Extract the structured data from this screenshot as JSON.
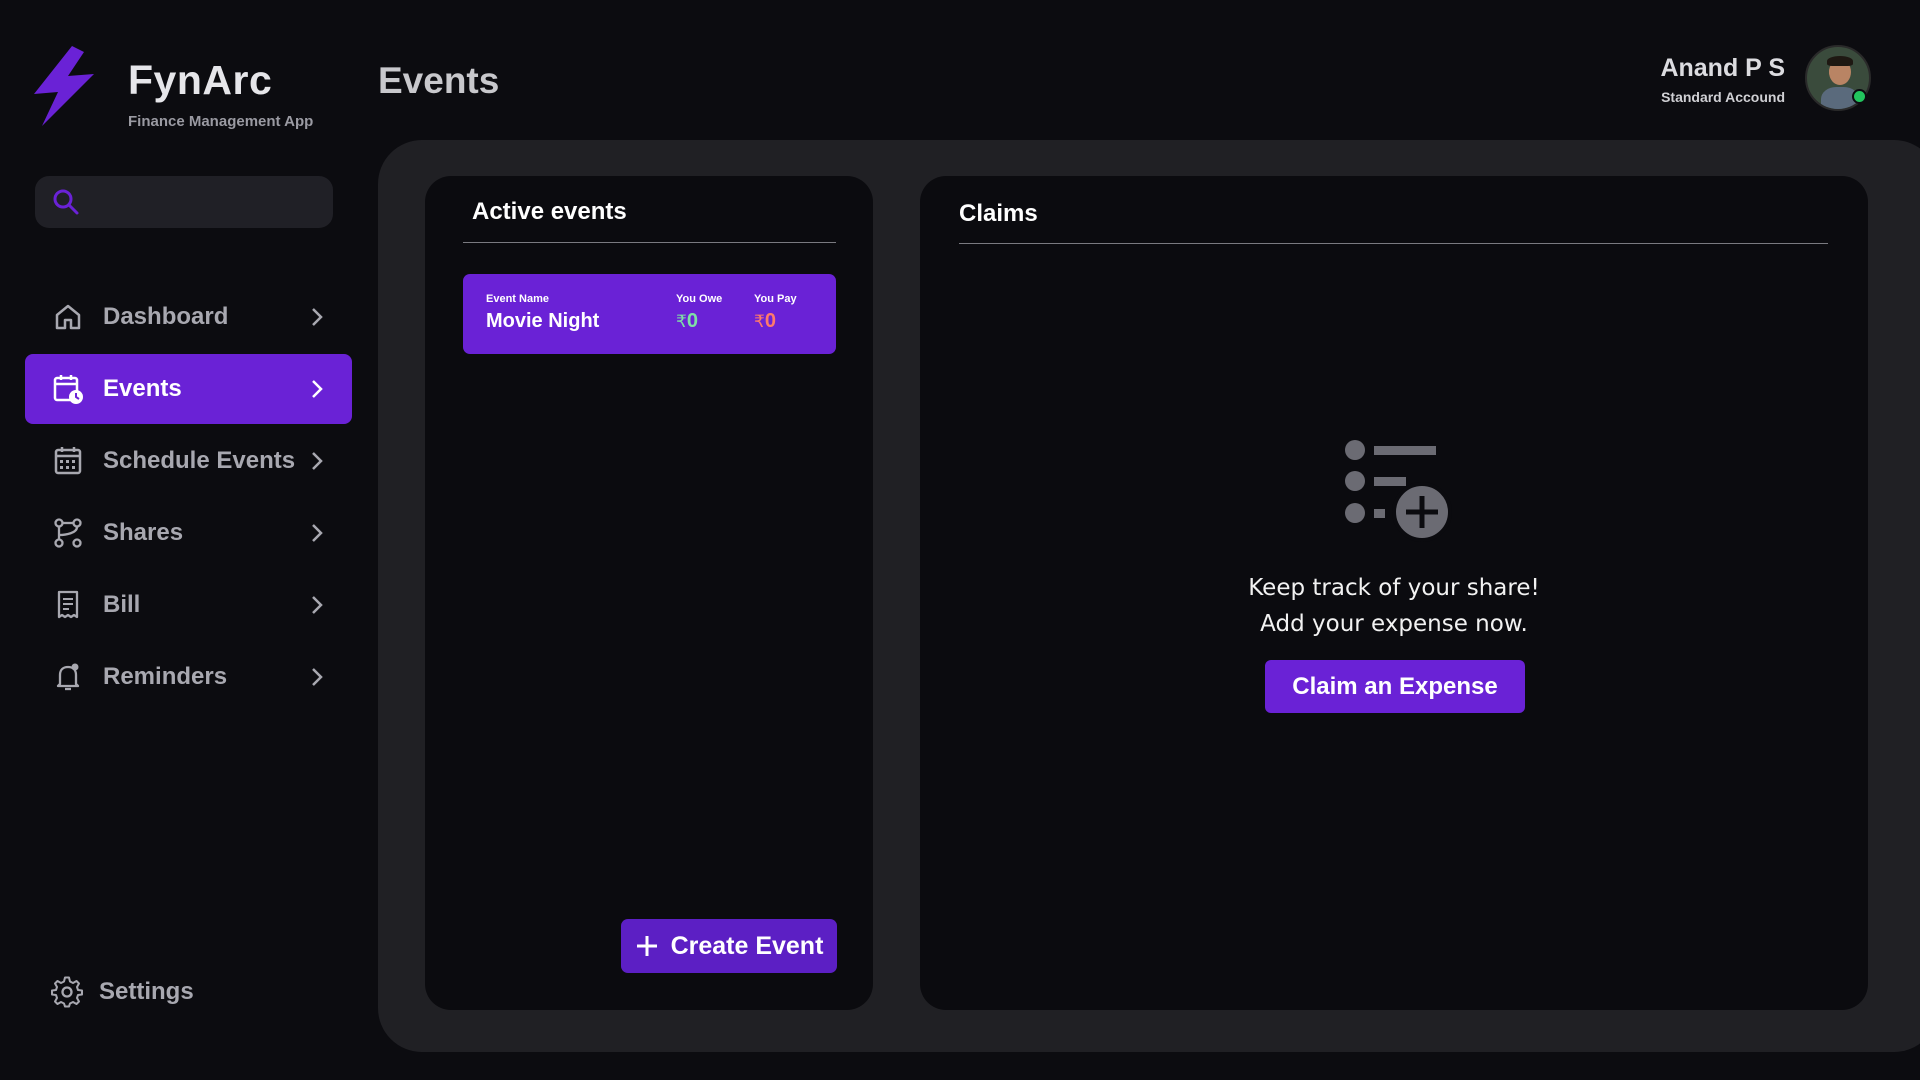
{
  "brand": {
    "name": "FynArc",
    "subtitle": "Finance Management App"
  },
  "search": {
    "placeholder": "",
    "value": ""
  },
  "nav": {
    "items": [
      {
        "label": "Dashboard",
        "icon": "home-icon",
        "active": false
      },
      {
        "label": "Events",
        "icon": "calendar-clock-icon",
        "active": true
      },
      {
        "label": "Schedule Events",
        "icon": "calendar-grid-icon",
        "active": false
      },
      {
        "label": "Shares",
        "icon": "share-nodes-icon",
        "active": false
      },
      {
        "label": "Bill",
        "icon": "receipt-icon",
        "active": false
      },
      {
        "label": "Reminders",
        "icon": "bell-icon",
        "active": false
      }
    ],
    "settings_label": "Settings"
  },
  "header": {
    "title": "Events"
  },
  "user": {
    "name": "Anand P S",
    "plan": "Standard Accound",
    "online": true
  },
  "events_panel": {
    "title": "Active events",
    "card": {
      "name_label": "Event Name",
      "name": "Movie Night",
      "owe_label": "You Owe",
      "owe_currency": "₹",
      "owe_value": "0",
      "pay_label": "You Pay",
      "pay_currency": "₹",
      "pay_value": "0"
    },
    "create_button": "Create Event"
  },
  "claims_panel": {
    "title": "Claims",
    "message_line1": "Keep track of your share!",
    "message_line2": "Add your expense now.",
    "claim_button": "Claim an Expense"
  },
  "colors": {
    "background": "#0c0c10",
    "accent": "#6a22d6",
    "panel": "#0b0b0f",
    "container": "#202024",
    "owe": "#7fe0a6",
    "pay": "#ff7a6a",
    "online": "#22c55e"
  }
}
